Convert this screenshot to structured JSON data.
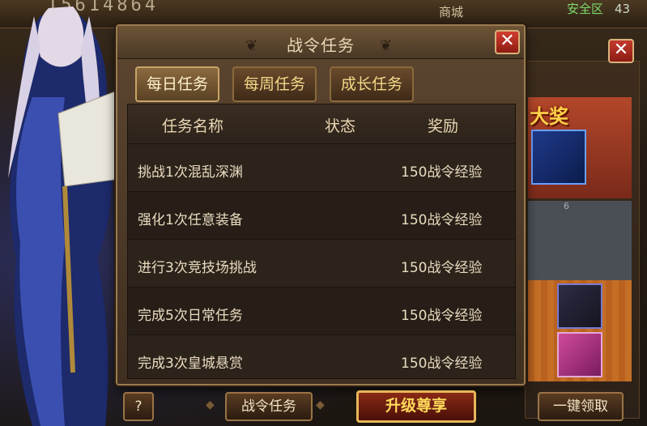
{
  "topbar": {
    "score": "15614864",
    "shop_label": "商城",
    "zone_label": "安全区",
    "zone_number": "43"
  },
  "dialog": {
    "title": "战令任务",
    "close_icon": "close-icon",
    "tabs": [
      {
        "label": "每日任务",
        "active": true
      },
      {
        "label": "每周任务",
        "active": false
      },
      {
        "label": "成长任务",
        "active": false
      }
    ],
    "table": {
      "headers": {
        "name": "任务名称",
        "status": "状态",
        "reward": "奖励"
      },
      "rows": [
        {
          "name": "挑战1次混乱深渊",
          "status": "",
          "reward": "150战令经验"
        },
        {
          "name": "强化1次任意装备",
          "status": "",
          "reward": "150战令经验"
        },
        {
          "name": "进行3次竞技场挑战",
          "status": "",
          "reward": "150战令经验"
        },
        {
          "name": "完成5次日常任务",
          "status": "",
          "reward": "150战令经验"
        },
        {
          "name": "完成3次皇城悬赏",
          "status": "",
          "reward": "150战令经验"
        }
      ]
    }
  },
  "side_panel": {
    "prize_title": "大奖",
    "count": "6"
  },
  "bottom": {
    "help_label": "?",
    "tasks_label": "战令任务",
    "upgrade_label": "升级尊享",
    "claim_all_label": "一键领取"
  },
  "colors": {
    "accent_gold": "#f2d888",
    "close_red": "#d23e30",
    "zone_green": "#7edc6a"
  }
}
